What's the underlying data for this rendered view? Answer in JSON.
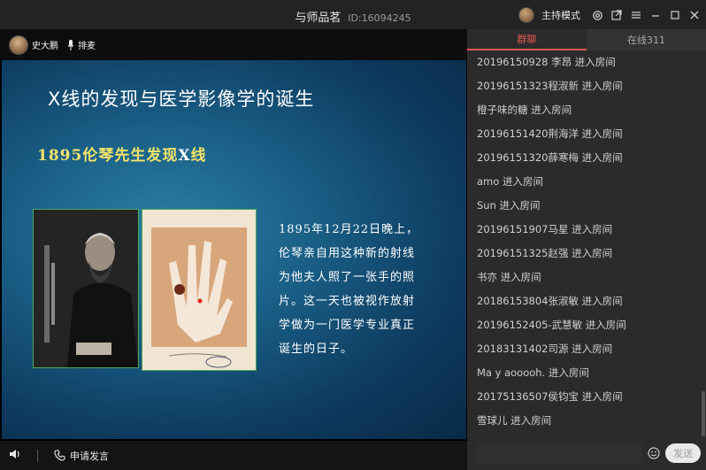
{
  "window": {
    "title": "与师品茗",
    "room_id": "ID:16094245",
    "mode_label": "主持模式"
  },
  "stage": {
    "host_name": "史大鹏",
    "mic_queue_label": "排麦",
    "apply_speak_label": "申请发言"
  },
  "slide": {
    "title": "X线的发现与医学影像学的诞生",
    "subtitle_pre": "1895伦琴先生发现",
    "subtitle_x": "X",
    "subtitle_post": "线",
    "body": [
      "1895年12月22日晚上，",
      "伦琴亲自用这种新的射线",
      "为他夫人照了一张手的照",
      "片。这一天也被视作放射",
      "学做为一门医学专业真正",
      "诞生的日子。"
    ]
  },
  "panel": {
    "tab_chat": "群聊",
    "tab_online": "在线311",
    "messages": [
      "20196150928  李昂 进入房间",
      "20196151323程淑新 进入房间",
      "橙子味的糖 进入房间",
      "20196151420荆海洋 进入房间",
      "20196151320薛寒梅 进入房间",
      "amo 进入房间",
      "Sun 进入房间",
      "20196151907马星 进入房间",
      "20196151325赵强 进入房间",
      "书亦 进入房间",
      "20186153804张淑敏 进入房间",
      "20196152405-武慧敏 进入房间",
      "20183131402司源 进入房间",
      "Ma y aooooh. 进入房间",
      "20175136507侯钧宝 进入房间",
      "雪球儿 进入房间"
    ],
    "send_label": "发送"
  },
  "colors": {
    "accent": "#e8574f",
    "subtitle": "#f3e36a"
  }
}
